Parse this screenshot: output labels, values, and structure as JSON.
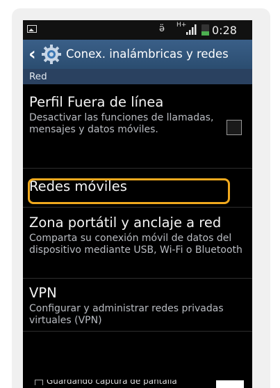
{
  "status_bar": {
    "time": "0:28",
    "icons": [
      "gallery-icon",
      "eye-icon",
      "hplus-icon",
      "signal-icon",
      "battery-icon"
    ],
    "network_label": "H+"
  },
  "action_bar": {
    "back_icon": "chevron-left-icon",
    "app_icon": "settings-gear-icon",
    "title": "Conex. inalámbricas y redes",
    "color": "#3a5f88"
  },
  "section": {
    "label": "Red"
  },
  "items": [
    {
      "title": "Perfil Fuera de línea",
      "subtitle": "Desactivar las funciones de llamadas, mensajes y datos móviles.",
      "checked": false
    },
    {
      "title": "Redes móviles",
      "highlighted": true
    },
    {
      "title": "Zona portátil y anclaje a red",
      "subtitle": "Comparta su conexión móvil de datos del dispositivo mediante USB, Wi-Fi o Bluetooth"
    },
    {
      "title": "VPN",
      "subtitle": "Configurar y administrar redes privadas virtuales (VPN)"
    }
  ],
  "toast": {
    "text": "Guardando captura de pantalla"
  },
  "colors": {
    "highlight": "#f0a91e",
    "section_bg": "#2a4160",
    "battery": "#4caf50"
  }
}
